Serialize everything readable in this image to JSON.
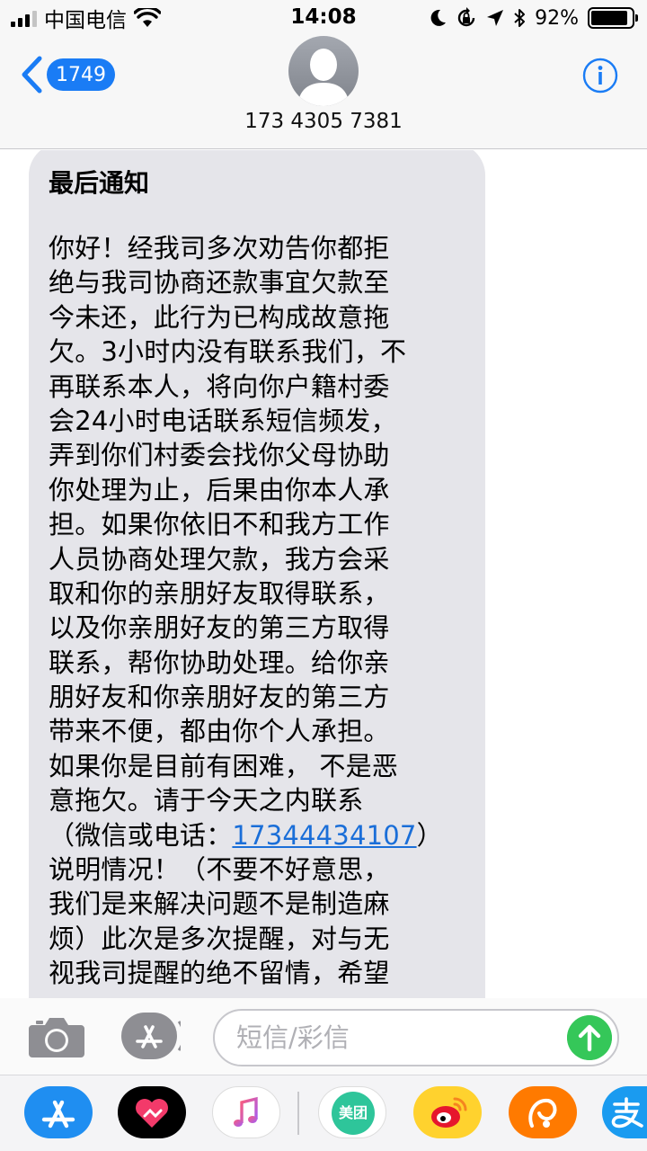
{
  "status_bar": {
    "carrier": "中国电信",
    "time": "14:08",
    "battery": "92%",
    "battery_level": 0.92
  },
  "header": {
    "back_badge": "1749",
    "contact": "173 4305 7381"
  },
  "message": {
    "title": "最后通知",
    "lines": [
      "你好！经我司多次劝告你都拒",
      "绝与我司协商还款事宜欠款至",
      "今未还，此行为已构成故意拖",
      "欠。3小时内没有联系我们，不",
      "再联系本人，将向你户籍村委",
      "会24小时电话联系短信频发，",
      "弄到你们村委会找你父母协助",
      "你处理为止，后果由你本人承",
      "担。如果你依旧不和我方工作",
      "人员协商处理欠款，我方会采",
      "取和你的亲朋好友取得联系，",
      "以及你亲朋好友的第三方取得",
      "联系，帮你协助处理。给你亲",
      "朋好友和你亲朋好友的第三方",
      "带来不便，都由你个人承担。",
      "如果你是目前有困难， 不是恶",
      "意拖欠。请于今天之内联系",
      "（微信或电话：",
      "说明情况！（不要不好意思，",
      "我们是来解决问题不是制造麻",
      "烦）此次是多次提醒，对与无",
      "视我司提醒的绝不留情，希望"
    ],
    "phone_link": "17344434107",
    "phone_suffix": "）"
  },
  "composer": {
    "placeholder": "短信/彩信"
  },
  "drawer": {
    "meituan_label": "美团"
  },
  "colors": {
    "accent": "#1a7cf5",
    "bubble": "#e5e5ea",
    "send": "#35c759"
  },
  "icons": [
    "signal-icon",
    "wifi-icon",
    "moon-icon",
    "rotation-lock-icon",
    "location-icon",
    "bluetooth-icon",
    "battery-icon",
    "back-chevron-icon",
    "avatar-icon",
    "info-icon",
    "camera-icon",
    "app-store-icon",
    "send-arrow-icon"
  ]
}
